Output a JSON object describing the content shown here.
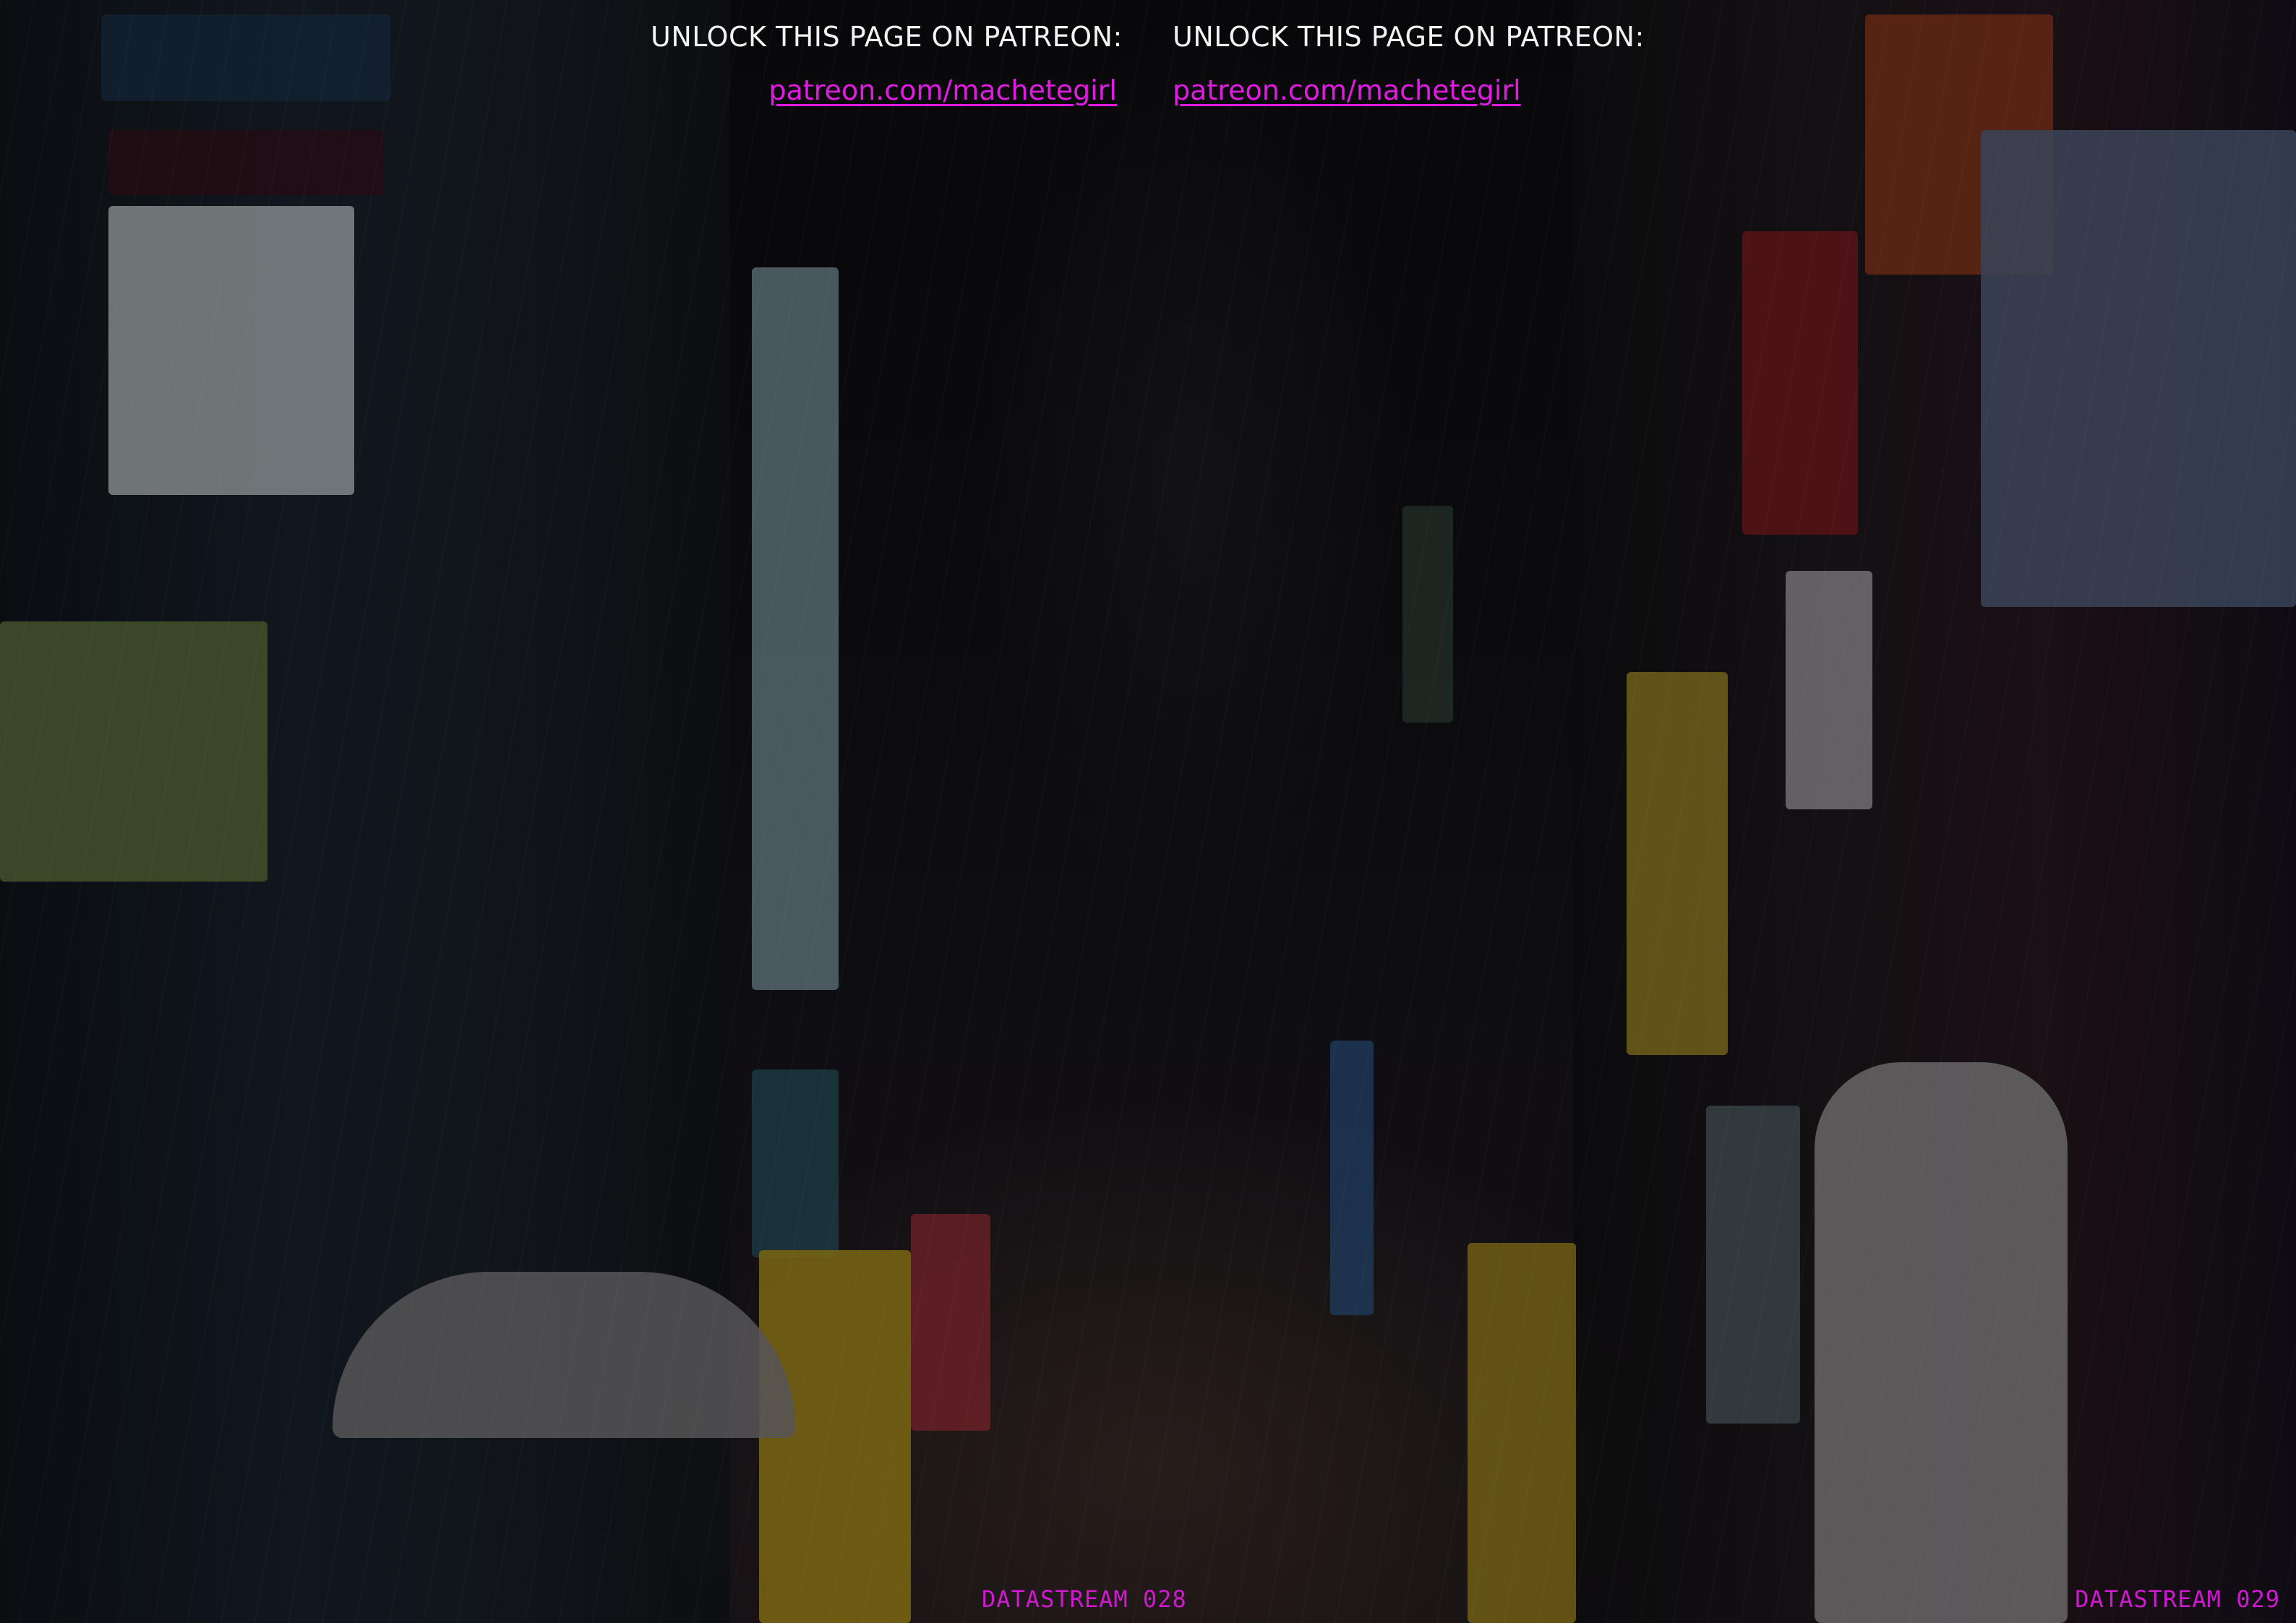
{
  "overlay": {
    "left": {
      "unlock_text": "UNLOCK THIS PAGE ON PATREON:",
      "link_text": "patreon.com/machetegirl"
    },
    "right": {
      "unlock_text": "UNLOCK THIS PAGE ON PATREON:",
      "link_text": "patreon.com/machetegirl"
    }
  },
  "page_labels": {
    "left": "DATASTREAM 028",
    "right": "DATASTREAM 029"
  },
  "colors": {
    "unlock_text": "#f3f3f3",
    "link": "#e21be3",
    "page_label": "#cf19d1"
  }
}
